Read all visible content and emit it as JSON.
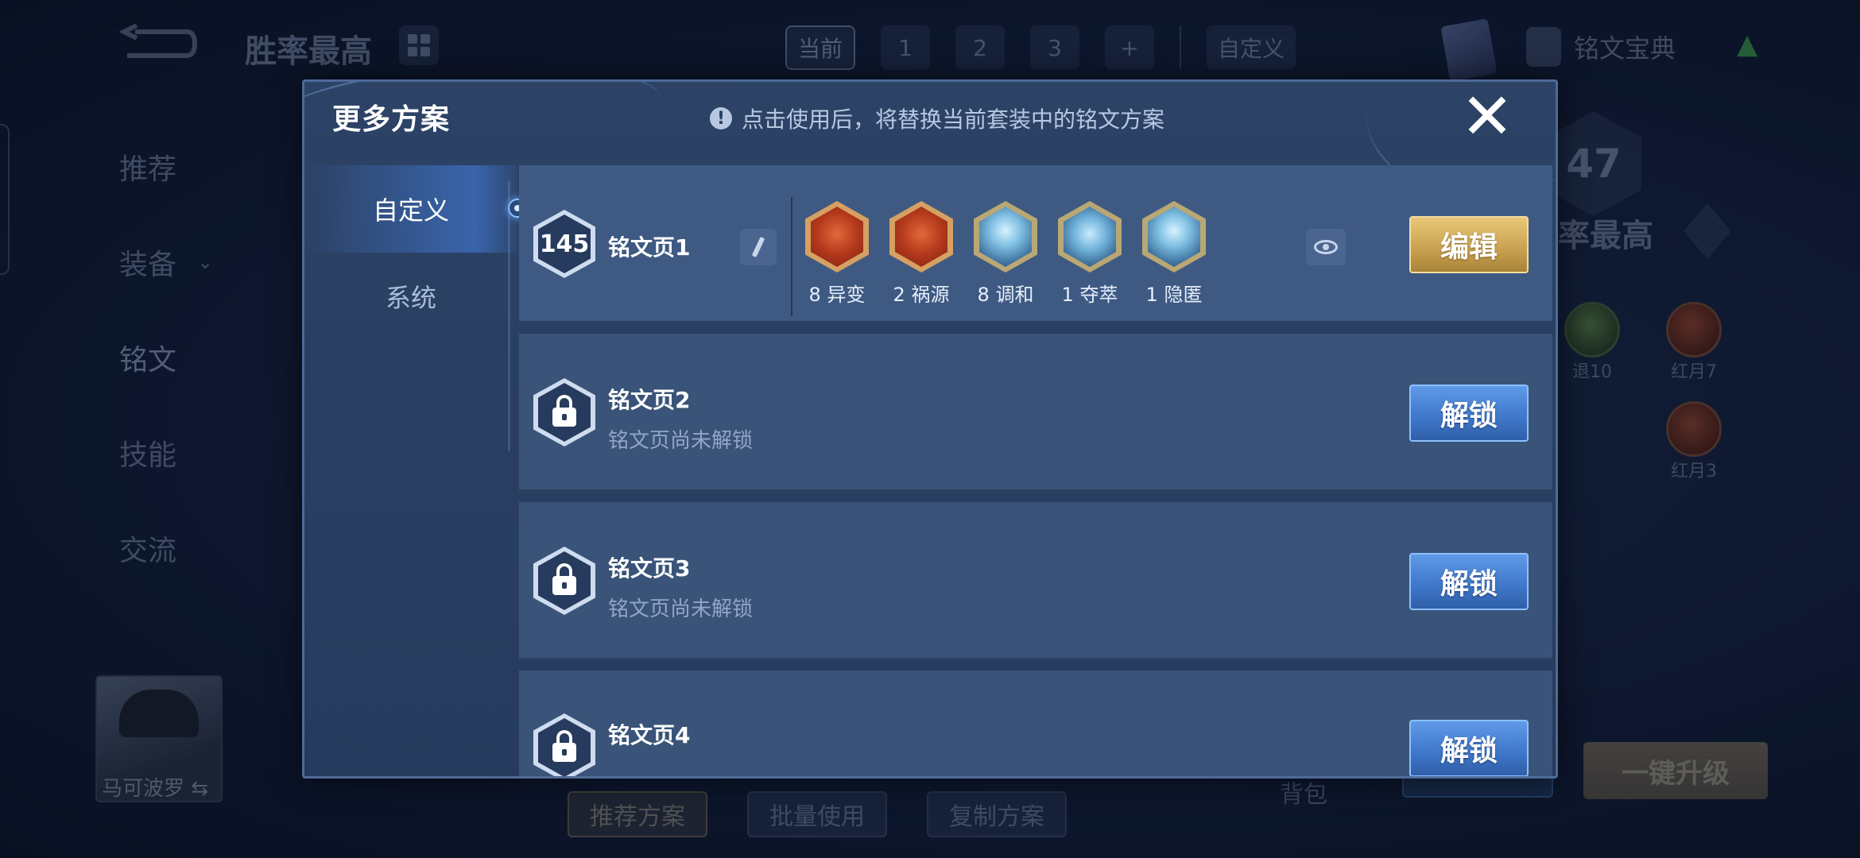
{
  "background": {
    "title": "胜率最高",
    "top_tabs": [
      "当前",
      "1",
      "2",
      "3",
      "+"
    ],
    "custom_tab": "自定义",
    "codex_label": "铭文宝典",
    "side_nav": [
      "推荐",
      "装备",
      "铭文",
      "技能",
      "交流"
    ],
    "right_badge": "47",
    "right_title": "率最高",
    "runes_right": [
      {
        "label": "退10"
      },
      {
        "label": "红月7"
      },
      {
        "label": "红月3"
      }
    ],
    "hero_name": "马可波罗",
    "bottom_buttons": [
      "推荐方案",
      "批量使用",
      "复制方案"
    ],
    "bag_label": "背包",
    "upgrade_label": "一键升级"
  },
  "modal": {
    "title": "更多方案",
    "notice": "点击使用后，将替换当前套装中的铭文方案",
    "notice_icon": "!",
    "close_symbol": "✕",
    "tabs": [
      {
        "label": "自定义",
        "active": true
      },
      {
        "label": "系统",
        "active": false
      }
    ],
    "pages": [
      {
        "name": "铭文页1",
        "level": "145",
        "runes": [
          {
            "count": "8",
            "name": "异变",
            "color": "red"
          },
          {
            "count": "2",
            "name": "祸源",
            "color": "red"
          },
          {
            "count": "8",
            "name": "调和",
            "color": "blue"
          },
          {
            "count": "1",
            "name": "夺萃",
            "color": "blue"
          },
          {
            "count": "1",
            "name": "隐匿",
            "color": "blue"
          }
        ],
        "rune_labels": [
          "8 异变",
          "2 祸源",
          "8 调和",
          "1 夺萃",
          "1 隐匿"
        ],
        "action": "编辑"
      },
      {
        "name": "铭文页2",
        "status": "铭文页尚未解锁",
        "action": "解锁"
      },
      {
        "name": "铭文页3",
        "status": "铭文页尚未解锁",
        "action": "解锁"
      },
      {
        "name": "铭文页4",
        "action": "解锁"
      }
    ]
  },
  "colors": {
    "gold_button": "#c8a050",
    "blue_button": "#3f76c8",
    "modal_bg": "#2d4366"
  }
}
